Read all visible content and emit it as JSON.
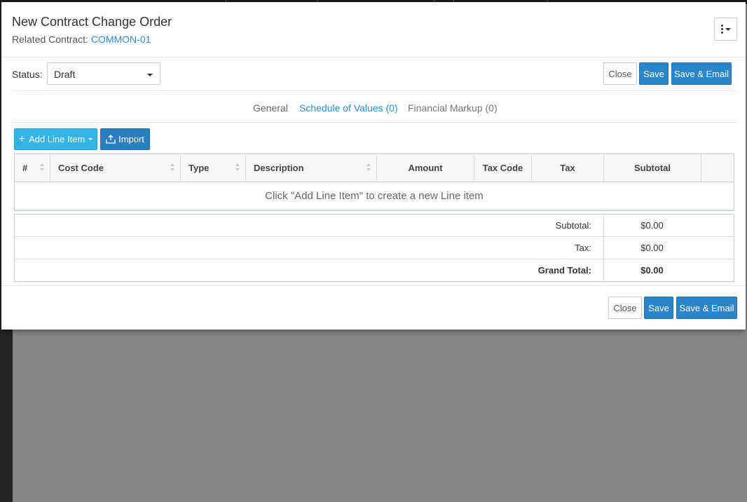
{
  "modal": {
    "title": "New Contract Change Order",
    "related_label": "Related Contract:",
    "related_value": "COMMON-01"
  },
  "status": {
    "label": "Status:",
    "value": "Draft"
  },
  "buttons": {
    "close": "Close",
    "save": "Save",
    "save_email": "Save & Email",
    "add_line_item": "Add Line Item",
    "import": "Import"
  },
  "tabs": {
    "general": "General",
    "sov": "Schedule of Values (0)",
    "financial": "Financial Markup (0)"
  },
  "table": {
    "columns": [
      "#",
      "Cost Code",
      "Type",
      "Description",
      "Amount",
      "Tax Code",
      "Tax",
      "Subtotal",
      ""
    ],
    "empty_message": "Click \"Add Line Item\" to create a new Line item"
  },
  "totals": {
    "subtotal_label": "Subtotal:",
    "subtotal_value": "$0.00",
    "tax_label": "Tax:",
    "tax_value": "$0.00",
    "grand_label": "Grand Total:",
    "grand_value": "$0.00"
  }
}
